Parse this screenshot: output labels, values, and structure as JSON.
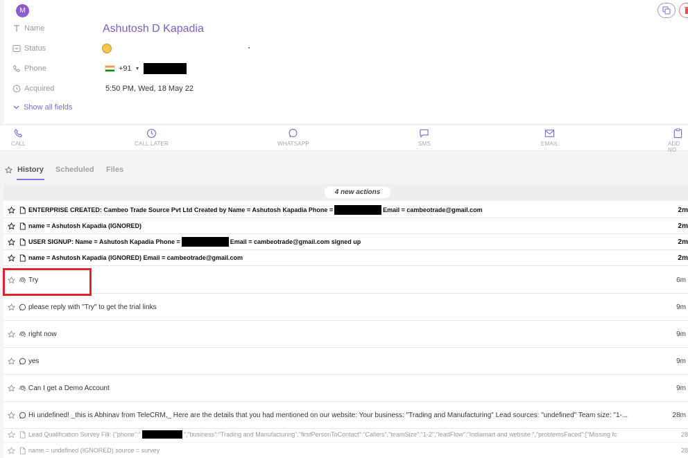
{
  "contact": {
    "avatar_letter": "M",
    "name": "Ashutosh D Kapadia",
    "phone_code": "+91",
    "acquired": "5:50 PM, Wed, 18 May 22"
  },
  "fields": {
    "name_label": "Name",
    "status_label": "Status",
    "phone_label": "Phone",
    "acquired_label": "Acquired",
    "show_all": "Show all fields"
  },
  "actions": [
    "CALL",
    "CALL LATER",
    "WHATSAPP",
    "SMS",
    "EMAIL",
    "ADD NO"
  ],
  "tabs": [
    "History",
    "Scheduled",
    "Files"
  ],
  "history": {
    "new_actions": "4 new actions",
    "bold_rows": [
      {
        "pre": "ENTERPRISE CREATED: Cambeo Trade Source Pvt Ltd Created by Name = Ashutosh Kapadia Phone =",
        "post": "Email = cambeotrade@gmail.com",
        "time": "2m"
      },
      {
        "pre": "name = Ashutosh Kapadia (IGNORED)",
        "post": "",
        "time": "2m"
      },
      {
        "pre": "USER SIGNUP: Name = Ashutosh Kapadia Phone =",
        "post": "Email = cambeotrade@gmail.com signed up",
        "time": "2m"
      },
      {
        "pre": "name = Ashutosh Kapadia (IGNORED) Email = cambeotrade@gmail.com",
        "post": "",
        "time": "2m"
      }
    ],
    "messages": [
      {
        "icon": "agent",
        "text": "Try",
        "time": "6m"
      },
      {
        "icon": "whatsapp",
        "text": "please reply with \"Try\" to get the trial links",
        "time": "9m"
      },
      {
        "icon": "agent",
        "text": "right now",
        "time": "9m"
      },
      {
        "icon": "whatsapp",
        "text": "yes",
        "time": "9m"
      },
      {
        "icon": "agent",
        "text": "Can I get a Demo Account",
        "time": "9m"
      },
      {
        "icon": "whatsapp",
        "text": "Hi undefined! _this is Abhinav from TeleCRM,_ Here are the details that you had mentioned on our website: Your business: \"Trading and Manufacturing\" Lead sources: \"undefined\" Team size: \"1-...",
        "time": "28m"
      }
    ],
    "small_rows": [
      {
        "pre": "Lead Qualification Survey Fill: {\"phone\":\"",
        "post": "\",\"business\":\"Trading and Manufacturing\",\"firstPersonToContact\":\"Callers\",\"teamSize\":\"1-2\",\"leadFlow\":\"Indiamart and website \",\"problemsFaced\":[\"Missing fc",
        "time": "28"
      },
      {
        "pre": "name = undefined (IGNORED) source = survey",
        "post": "",
        "time": "28"
      }
    ]
  },
  "colors": {
    "accent": "#7b5ec7",
    "highlight": "#e0242e"
  }
}
